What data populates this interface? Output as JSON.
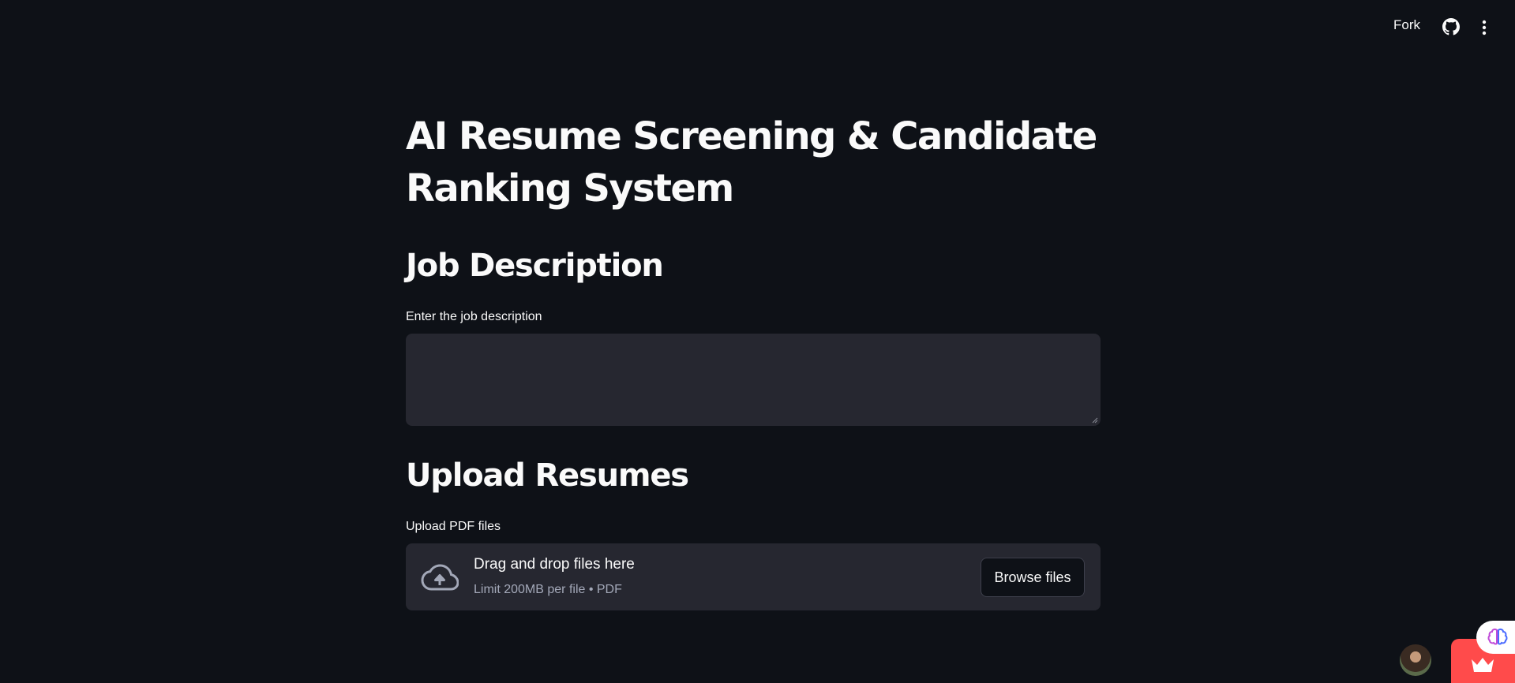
{
  "header": {
    "fork_label": "Fork",
    "icons": [
      "github-icon",
      "more-vertical-icon"
    ]
  },
  "main": {
    "title": "AI Resume Screening & Candidate Ranking System",
    "job_section": {
      "heading": "Job Description",
      "field_label": "Enter the job description",
      "value": ""
    },
    "upload_section": {
      "heading": "Upload Resumes",
      "field_label": "Upload PDF files",
      "dropzone_title": "Drag and drop files here",
      "dropzone_subtitle": "Limit 200MB per file • PDF",
      "browse_label": "Browse files",
      "icon": "cloud-upload-icon"
    }
  },
  "widgets": {
    "icons": [
      "avatar",
      "crown-icon",
      "brain-icon"
    ],
    "accent": "#ff4b4b"
  },
  "colors": {
    "background": "#0e1117",
    "input_bg": "#262730",
    "text": "#fafafa",
    "muted_text": "#a3a8b8"
  }
}
